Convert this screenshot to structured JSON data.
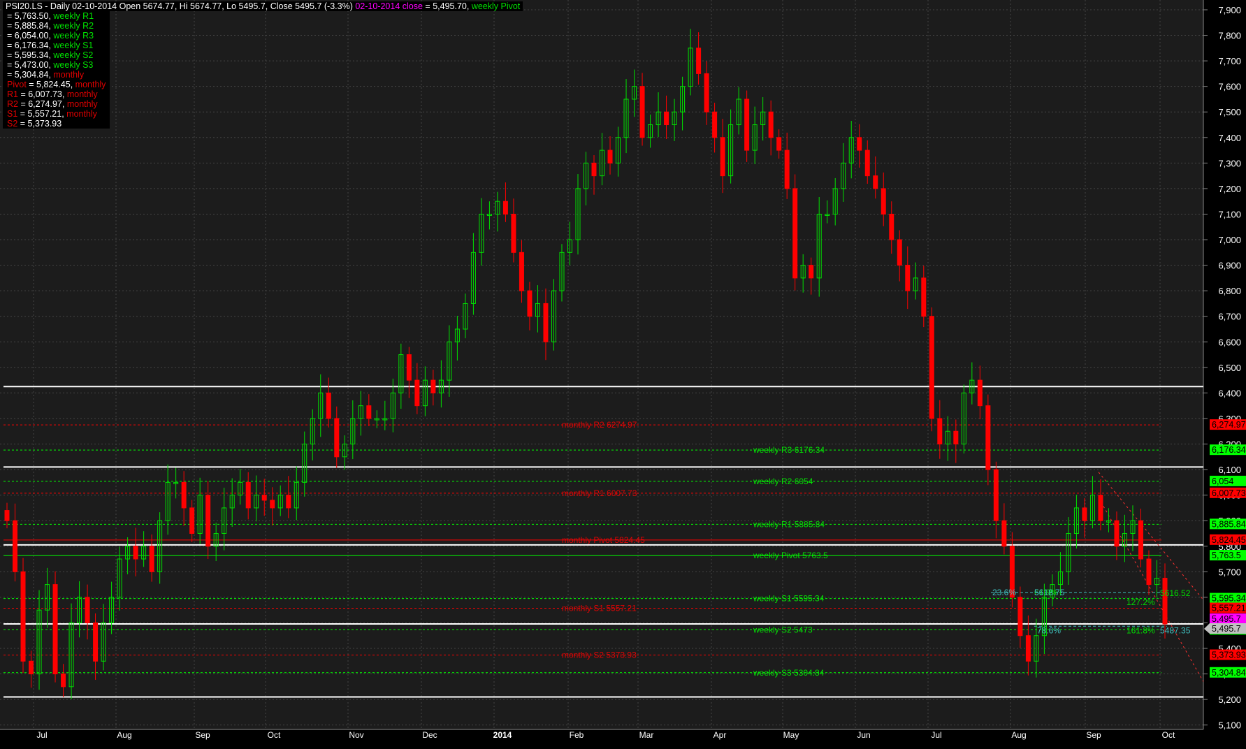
{
  "header": {
    "title": "PSI20.LS - Daily 02-10-2014 Open 5674.77, Hi 5674.77, Lo 5495.7, Close 5495.7 (-3.3%)",
    "close_label": "02-10-2014 close",
    "close_value": " = 5,495.70, ",
    "first_series": "weekly Pivot"
  },
  "legend": [
    {
      "value": " = 5,763.50, ",
      "next": "weekly R1",
      "color": "g"
    },
    {
      "value": " = 5,885.84, ",
      "next": "weekly R2",
      "color": "g"
    },
    {
      "value": " = 6,054.00, ",
      "next": "weekly R3",
      "color": "g"
    },
    {
      "value": " = 6,176.34, ",
      "next": "weekly S1",
      "color": "g"
    },
    {
      "value": " = 5,595.34, ",
      "next": "weekly S2",
      "color": "g"
    },
    {
      "value": " = 5,473.00, ",
      "next": "weekly S3",
      "color": "g"
    },
    {
      "value": " = 5,304.84, ",
      "next": "monthly",
      "color": "r"
    },
    {
      "prefix": "Pivot",
      "value": " = 5,824.45, ",
      "next": "monthly",
      "color": "r"
    },
    {
      "prefix": "R1",
      "value": " = 6,007.73, ",
      "next": "monthly",
      "color": "r"
    },
    {
      "prefix": "R2",
      "value": " = 6,274.97, ",
      "next": "monthly",
      "color": "r"
    },
    {
      "prefix": "S1",
      "value": " = 5,557.21, ",
      "next": "monthly",
      "color": "r"
    },
    {
      "prefix": "S2",
      "value": " = 5,373.93",
      "next": "",
      "color": "r"
    }
  ],
  "chart_data": {
    "type": "candlestick",
    "symbol": "PSI20.LS",
    "ylim": [
      5100,
      7900
    ],
    "y_ticks": [
      7900,
      7800,
      7700,
      7600,
      7500,
      7400,
      7300,
      7200,
      7100,
      7000,
      6900,
      6800,
      6700,
      6600,
      6500,
      6400,
      6300,
      6200,
      6100,
      6000,
      5900,
      5800,
      5700,
      5600,
      5500,
      5400,
      5300,
      5200,
      5100
    ],
    "x_ticks": [
      "Jul",
      "Aug",
      "Sep",
      "Oct",
      "Nov",
      "Dec",
      "2014",
      "Feb",
      "Mar",
      "Apr",
      "May",
      "Jun",
      "Jul",
      "Aug",
      "Sep",
      "Oct"
    ],
    "close": [
      5900,
      5700,
      5350,
      5300,
      5550,
      5650,
      5300,
      5250,
      5500,
      5600,
      5500,
      5350,
      5500,
      5600,
      5750,
      5800,
      5750,
      5800,
      5700,
      5900,
      6050,
      6050,
      5950,
      5850,
      6000,
      5800,
      5850,
      5950,
      6000,
      6050,
      5950,
      6000,
      5980,
      5950,
      6000,
      5950,
      6050,
      6200,
      6300,
      6400,
      6300,
      6150,
      6200,
      6300,
      6350,
      6300,
      6300,
      6300,
      6400,
      6550,
      6450,
      6350,
      6450,
      6400,
      6450,
      6600,
      6650,
      6750,
      6950,
      7100,
      7100,
      7150,
      7100,
      6950,
      6800,
      6700,
      6750,
      6600,
      6800,
      6950,
      7000,
      7200,
      7300,
      7250,
      7350,
      7300,
      7400,
      7550,
      7600,
      7400,
      7450,
      7500,
      7450,
      7500,
      7600,
      7750,
      7650,
      7500,
      7400,
      7250,
      7450,
      7550,
      7350,
      7450,
      7500,
      7400,
      7350,
      7200,
      6850,
      6900,
      6850,
      7100,
      7100,
      7200,
      7300,
      7400,
      7350,
      7250,
      7200,
      7100,
      7000,
      6900,
      6800,
      6850,
      6700,
      6300,
      6200,
      6250,
      6200,
      6400,
      6450,
      6350,
      6100,
      5900,
      5800,
      5600,
      5450,
      5350,
      5450,
      5600,
      5650,
      5700,
      5850,
      5950,
      5900,
      6000,
      5900,
      5900,
      5800,
      5850,
      5900,
      5750,
      5650,
      5674.77,
      5495.7
    ],
    "white_lines": [
      6425,
      6110,
      5805,
      5495.7,
      5210
    ],
    "pivot_levels": [
      {
        "label": "monthly R2 6274.97",
        "value": 6274.97,
        "tag": "6,274.97",
        "color": "#ff0000",
        "group": "monthly",
        "style": "dashed"
      },
      {
        "label": "weekly R3 6176.34",
        "value": 6176.34,
        "tag": "6,176.34",
        "color": "#00ff00",
        "group": "weekly",
        "style": "dashed"
      },
      {
        "label": "weekly R2 6054",
        "value": 6054,
        "tag": "6,054",
        "color": "#00ff00",
        "group": "weekly",
        "style": "dashed"
      },
      {
        "label": "monthly R1 6007.73",
        "value": 6007.73,
        "tag": "6,007.73",
        "color": "#ff0000",
        "group": "monthly",
        "style": "dashed"
      },
      {
        "label": "weekly R1 5885.84",
        "value": 5885.84,
        "tag": "5,885.84",
        "color": "#00ff00",
        "group": "weekly",
        "style": "dashed"
      },
      {
        "label": "monthly Pivot 5824.45",
        "value": 5824.45,
        "tag": "5,824.45",
        "color": "#ff0000",
        "group": "monthly",
        "style": "solid"
      },
      {
        "label": "weekly Pivot 5763.5",
        "value": 5763.5,
        "tag": "5,763.5",
        "color": "#00ff00",
        "group": "weekly",
        "style": "solid"
      },
      {
        "label": "weekly S1 5595.34",
        "value": 5595.34,
        "tag": "5,595.34",
        "color": "#00ff00",
        "group": "weekly",
        "style": "dashed"
      },
      {
        "label": "monthly S1 5557.21",
        "value": 5557.21,
        "tag": "5,557.21",
        "color": "#ff0000",
        "group": "monthly",
        "style": "dashed"
      },
      {
        "label": "weekly S2 5473",
        "value": 5473,
        "tag": "5,473",
        "color": "#00ff00",
        "group": "weekly",
        "style": "dashed"
      },
      {
        "label": "monthly S2 5373.93",
        "value": 5373.93,
        "tag": "5,373.93",
        "color": "#ff0000",
        "group": "monthly",
        "style": "dashed"
      },
      {
        "label": "weekly S3 5304.84",
        "value": 5304.84,
        "tag": "5,304.84",
        "color": "#00ff00",
        "group": "weekly",
        "style": "dashed"
      }
    ],
    "close_tags": [
      {
        "tag": "5,495.7",
        "value": 5495.7,
        "color": "#ff00ff"
      },
      {
        "tag": "5,495.7",
        "value": 5495.7,
        "color": "#c0c0c0",
        "pointer": true
      }
    ],
    "fib_labels": [
      {
        "text": "23.6%",
        "value": 5618.75,
        "color": "#40c0c0",
        "pos": 0
      },
      {
        "text": "61.8%",
        "value": 5618.75,
        "color": "#00dd00",
        "pos": 1
      },
      {
        "text": "5618.75",
        "value": 5618.75,
        "color": "#40c0c0",
        "pos": 1
      },
      {
        "text": "127.2%",
        "value": 5580,
        "color": "#00dd00",
        "pos": 2
      },
      {
        "text": "5616.52",
        "value": 5616.52,
        "color": "#00dd00",
        "pos": 3
      },
      {
        "text": "78.6%",
        "value": 5470,
        "color": "#40c0c0",
        "pos": 4
      },
      {
        "text": "161.8%",
        "value": 5470,
        "color": "#00dd00",
        "pos": 2
      },
      {
        "text": "5487.35",
        "value": 5470,
        "color": "#40c0c0",
        "pos": 3
      }
    ]
  }
}
